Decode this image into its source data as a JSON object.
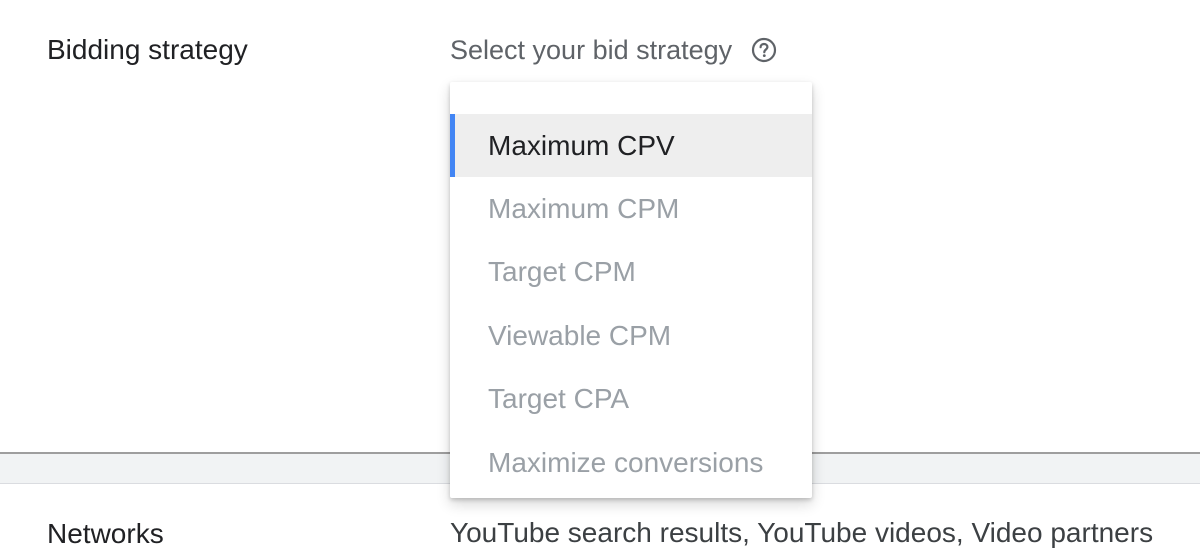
{
  "bidding": {
    "label": "Bidding strategy",
    "select_placeholder": "Select your bid strategy",
    "help_icon": "help-circle-icon",
    "options": [
      {
        "label": "Maximum CPV",
        "selected": true
      },
      {
        "label": "Maximum CPM",
        "selected": false
      },
      {
        "label": "Target CPM",
        "selected": false
      },
      {
        "label": "Viewable CPM",
        "selected": false
      },
      {
        "label": "Target CPA",
        "selected": false
      },
      {
        "label": "Maximize conversions",
        "selected": false
      }
    ]
  },
  "networks": {
    "label": "Networks",
    "value": "YouTube search results, YouTube videos, Video partners"
  },
  "colors": {
    "accent": "#4285f4",
    "selected_bg": "#eeeeee",
    "muted_text": "#9aa0a6"
  }
}
